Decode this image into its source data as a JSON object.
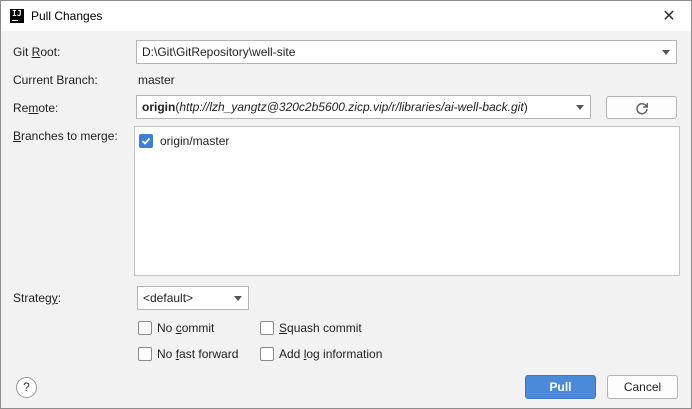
{
  "window": {
    "title": "Pull Changes",
    "close_icon": "close-icon",
    "app_icon": "intellij-icon",
    "app_icon_text": "IJ"
  },
  "git_root": {
    "label_pre": "Git ",
    "label_u": "R",
    "label_post": "oot:",
    "value": "D:\\Git\\GitRepository\\well-site"
  },
  "current_branch": {
    "label": "Current Branch:",
    "value": "master"
  },
  "remote": {
    "label_pre": "Re",
    "label_u": "m",
    "label_post": "ote:",
    "name": "origin",
    "url": "http://lzh_yangtz@320c2b5600.zicp.vip/r/libraries/ai-well-back.git",
    "open_paren": "(",
    "close_paren": ")",
    "refresh_icon": "refresh-icon"
  },
  "branches": {
    "label_u": "B",
    "label_post": "ranches to merge:",
    "items": [
      {
        "label": "origin/master",
        "checked": true
      }
    ]
  },
  "strategy": {
    "label_pre": "Strateg",
    "label_u": "y",
    "label_post": ":",
    "value": "<default>"
  },
  "options": {
    "no_commit": {
      "pre": "No ",
      "u": "c",
      "post": "ommit",
      "checked": false
    },
    "squash_commit": {
      "pre": "",
      "u": "S",
      "post": "quash commit",
      "checked": false
    },
    "no_fast_forward": {
      "pre": "No ",
      "u": "f",
      "post": "ast forward",
      "checked": false
    },
    "add_log": {
      "pre": "Add ",
      "u": "l",
      "post": "og information",
      "checked": false
    }
  },
  "footer": {
    "help": "?",
    "pull": "Pull",
    "cancel": "Cancel"
  },
  "colors": {
    "accent": "#4a8ad8",
    "checkbox_checked": "#3d7fd6"
  }
}
